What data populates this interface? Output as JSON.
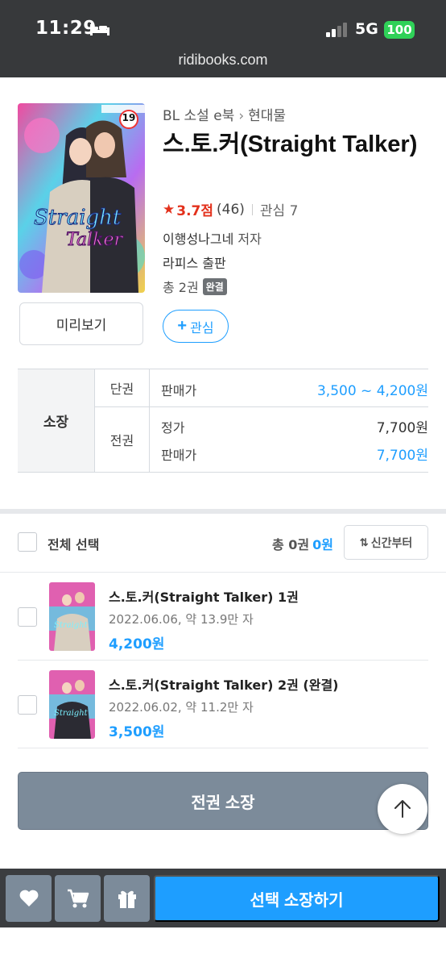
{
  "status_bar": {
    "time": "11:29",
    "network": "5G",
    "battery": "100"
  },
  "browser": {
    "url": "ridibooks.com"
  },
  "book": {
    "category": "BL 소설 e북",
    "subcategory": "현대물",
    "title": "스.토.커(Straight Talker)",
    "rating": "3.7점",
    "rating_count": "(46)",
    "interest": "관심 7",
    "author": "이행성나그네",
    "author_role": "저자",
    "publisher": "라피스",
    "publisher_role": "출판",
    "total_volumes": "총 2권",
    "complete_badge": "완결",
    "cover_age_badge": "19",
    "preview_label": "미리보기",
    "favorite_label": "관심"
  },
  "price_table": {
    "own_label": "소장",
    "single": {
      "type": "단권",
      "label": "판매가",
      "value": "3,500 ~ 4,200원"
    },
    "full": {
      "type": "전권",
      "list_label": "정가",
      "list_value": "7,700원",
      "sale_label": "판매가",
      "sale_value": "7,700원"
    }
  },
  "list_header": {
    "select_all": "전체 선택",
    "total_label": "총 0권",
    "total_price": "0원",
    "sort_label": "신간부터"
  },
  "items": [
    {
      "title": "스.토.커(Straight Talker) 1권",
      "meta": "2022.06.06, 약 13.9만 자",
      "price": "4,200원"
    },
    {
      "title": "스.토.커(Straight Talker) 2권 (완결)",
      "meta": "2022.06.02, 약 11.2만 자",
      "price": "3,500원"
    }
  ],
  "actions": {
    "buy_all": "전권 소장",
    "buy_selected": "선택 소장하기",
    "icons": [
      "heart-icon",
      "cart-icon",
      "gift-icon",
      "arrow-up-icon"
    ]
  },
  "colors": {
    "accent": "#1e9eff",
    "rating_red": "#e3311c",
    "button_gray": "#7c8b9a",
    "bar_dark": "#3b3d40"
  }
}
